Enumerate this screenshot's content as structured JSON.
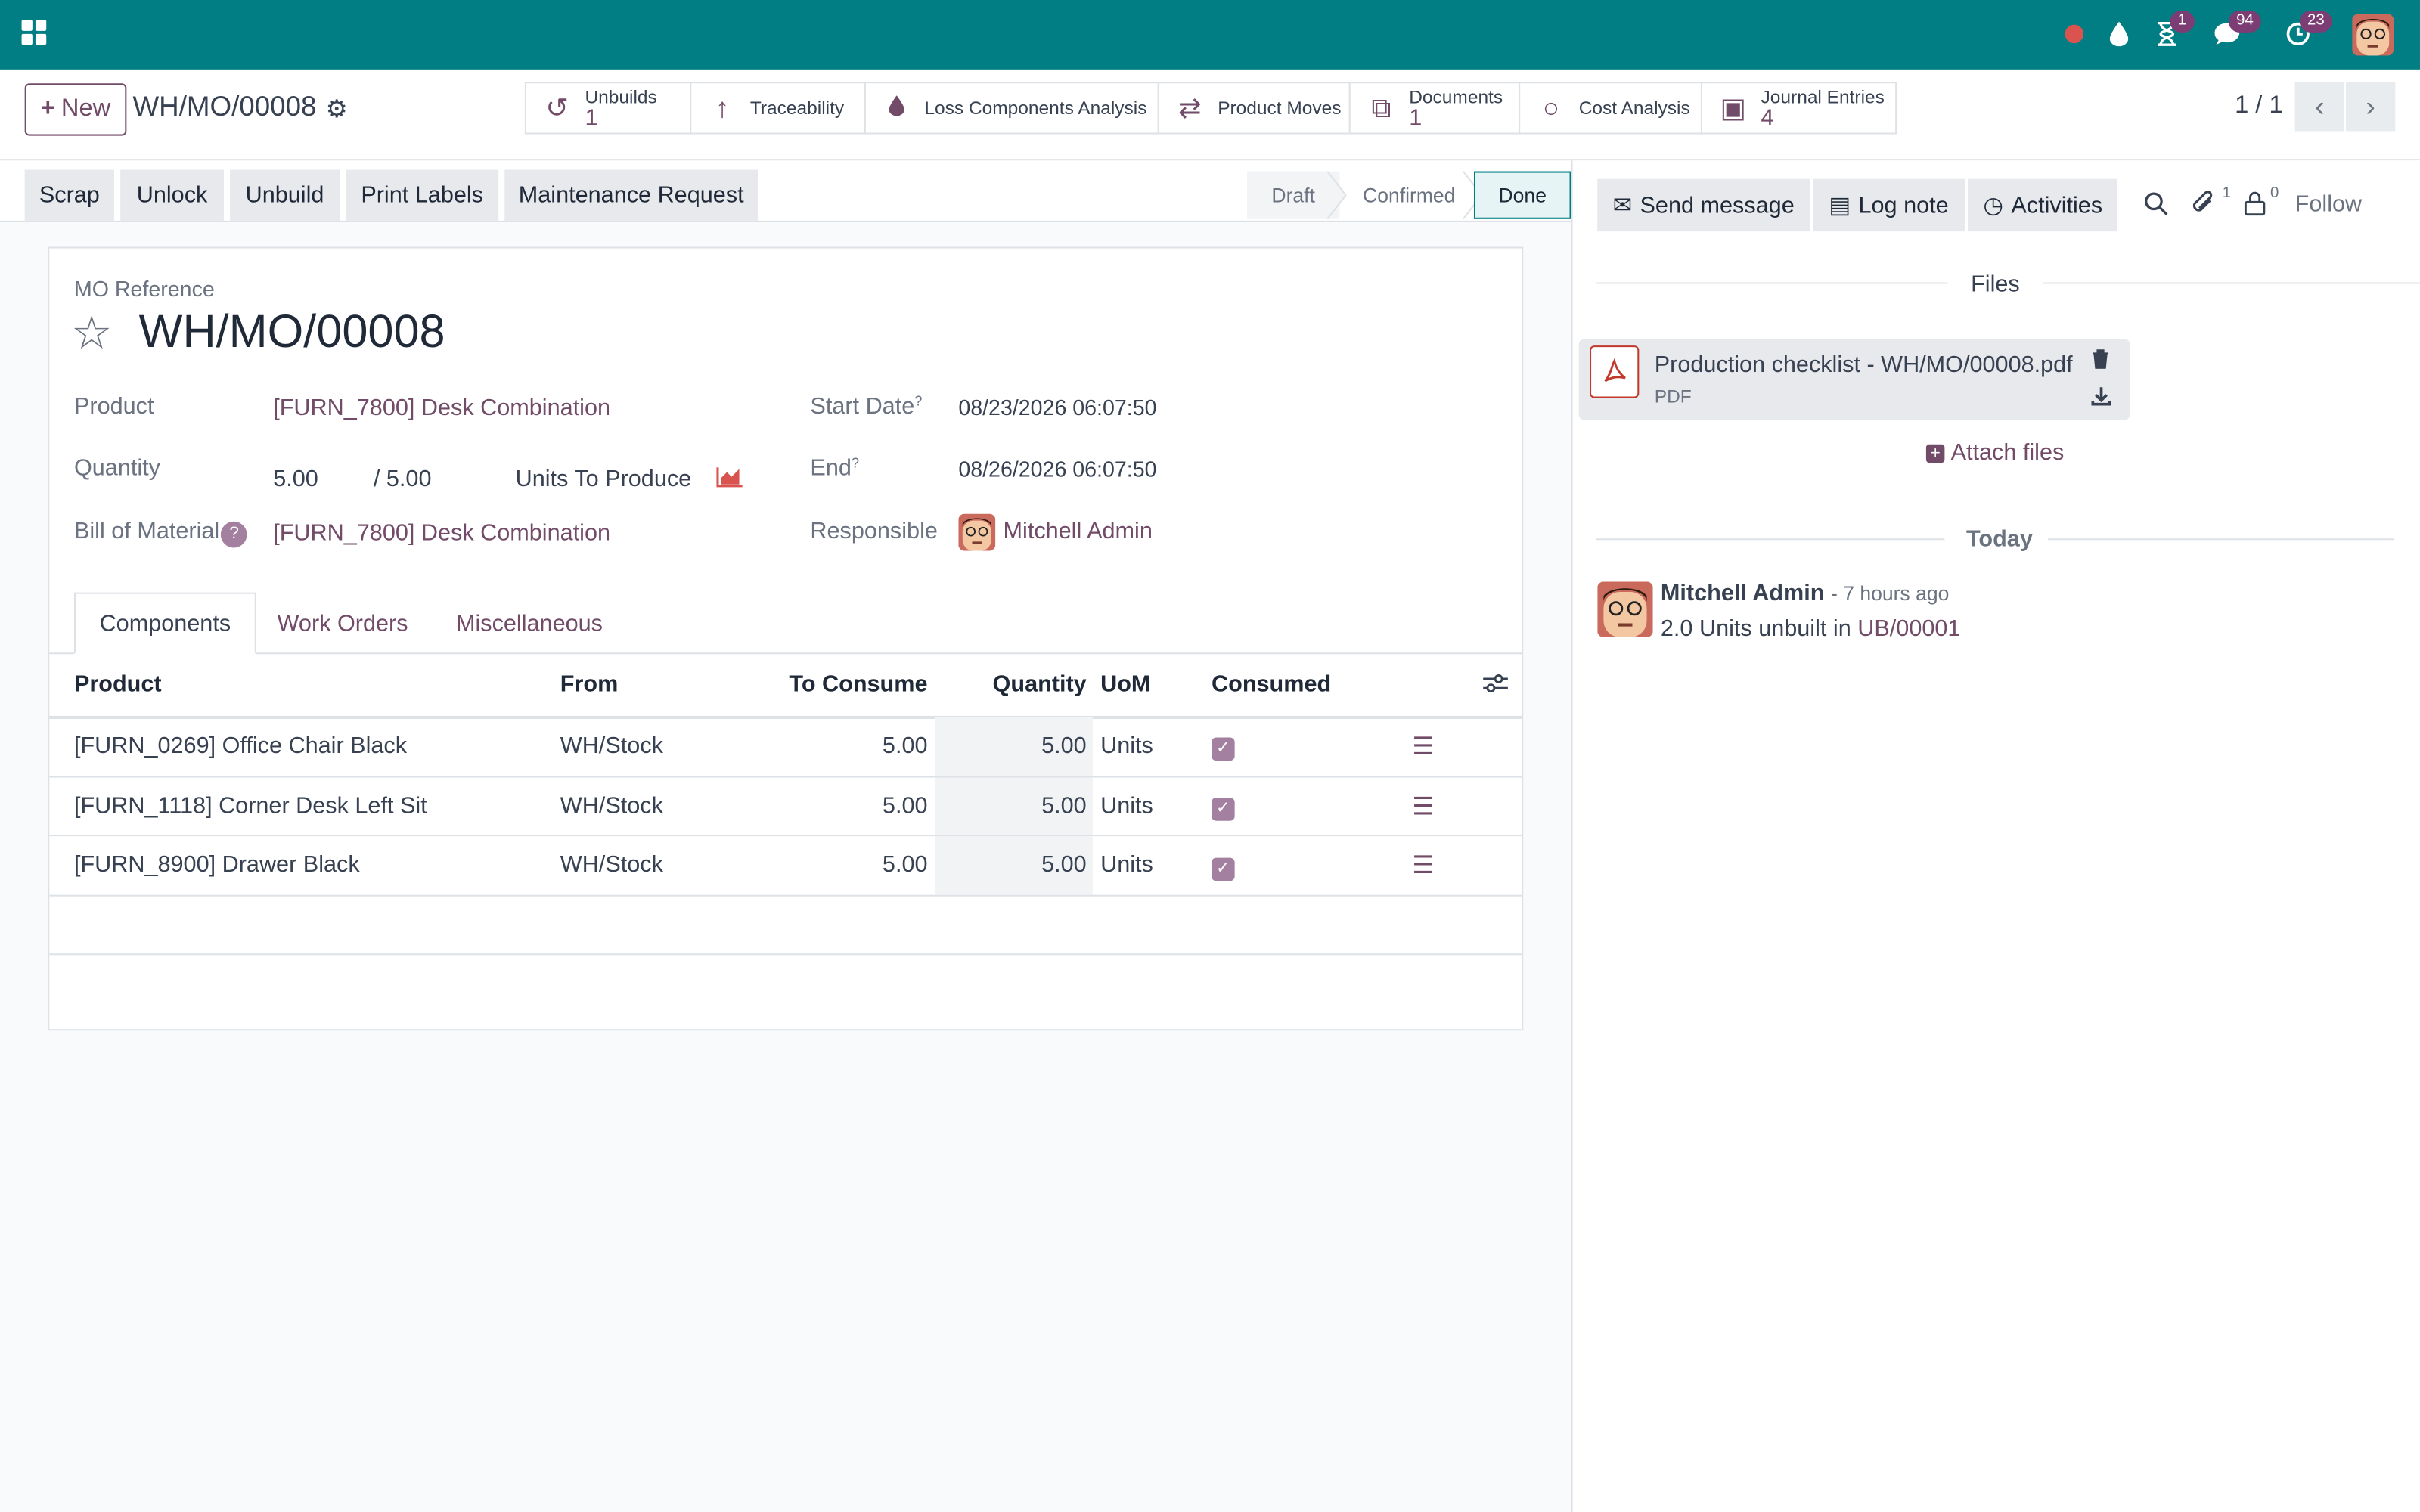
{
  "topbar": {
    "msg_count": "94",
    "activity_count": "23",
    "timer_count": "1"
  },
  "control": {
    "new_label": "New",
    "breadcrumb": "WH/MO/00008",
    "pager": "1 / 1"
  },
  "smart_buttons": [
    {
      "label": "Unbuilds",
      "value": "1"
    },
    {
      "label": "Traceability"
    },
    {
      "label": "Loss Components Analysis"
    },
    {
      "label": "Product Moves"
    },
    {
      "label": "Documents",
      "value": "1"
    },
    {
      "label": "Cost Analysis"
    },
    {
      "label": "Journal Entries",
      "value": "4"
    }
  ],
  "actions": [
    "Scrap",
    "Unlock",
    "Unbuild",
    "Print Labels",
    "Maintenance Request"
  ],
  "statusbar": [
    "Draft",
    "Confirmed",
    "Done"
  ],
  "form": {
    "ref_label": "MO Reference",
    "ref": "WH/MO/00008",
    "product_label": "Product",
    "product": "[FURN_7800] Desk Combination",
    "quantity_label": "Quantity",
    "qty": "5.00",
    "qty_total": "/ 5.00",
    "uom": "Units To Produce",
    "bom_label": "Bill of Material",
    "bom": "[FURN_7800] Desk Combination",
    "start_label": "Start Date",
    "start": "08/23/2026 06:07:50",
    "end_label": "End",
    "end": "08/26/2026 06:07:50",
    "responsible_label": "Responsible",
    "responsible": "Mitchell Admin",
    "help_mark": "?"
  },
  "tabs": [
    "Components",
    "Work Orders",
    "Miscellaneous"
  ],
  "table": {
    "headers": [
      "Product",
      "From",
      "To Consume",
      "Quantity",
      "UoM",
      "Consumed"
    ],
    "rows": [
      {
        "product": "[FURN_0269] Office Chair Black",
        "from": "WH/Stock",
        "to_consume": "5.00",
        "quantity": "5.00",
        "uom": "Units"
      },
      {
        "product": "[FURN_1118] Corner Desk Left Sit",
        "from": "WH/Stock",
        "to_consume": "5.00",
        "quantity": "5.00",
        "uom": "Units"
      },
      {
        "product": "[FURN_8900] Drawer Black",
        "from": "WH/Stock",
        "to_consume": "5.00",
        "quantity": "5.00",
        "uom": "Units"
      }
    ]
  },
  "chatter": {
    "send_message": "Send message",
    "log_note": "Log note",
    "activities": "Activities",
    "attach_count": "1",
    "follower_count": "0",
    "follow": "Follow",
    "files_heading": "Files",
    "attachment_name": "Production checklist - WH/MO/00008.pdf",
    "attachment_type": "PDF",
    "attach_files": "Attach files",
    "today": "Today",
    "msg_author": "Mitchell Admin",
    "msg_time": "- 7 hours ago",
    "msg_text": "2.0 Units unbuilt in",
    "msg_link": "UB/00001"
  },
  "colors": {
    "brand": "#017e84",
    "accent": "#714b67"
  }
}
